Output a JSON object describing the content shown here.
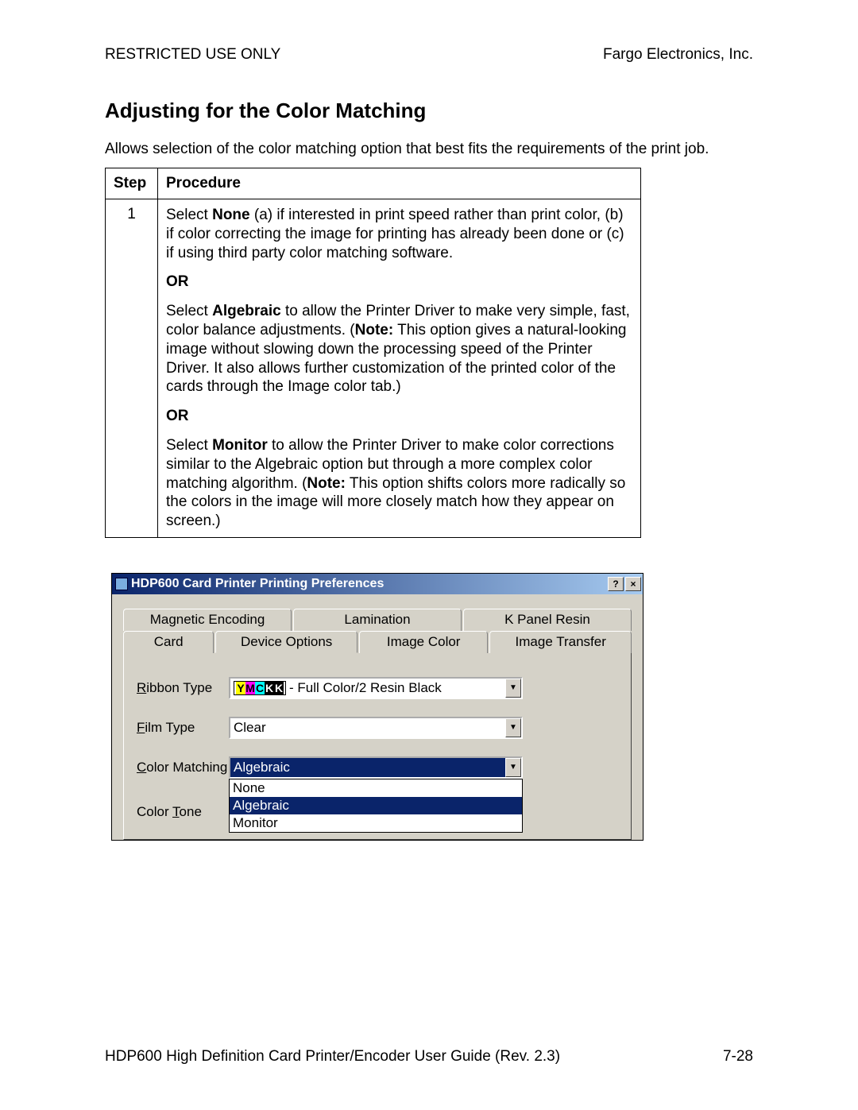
{
  "header": {
    "left": "RESTRICTED USE ONLY",
    "right": "Fargo Electronics, Inc."
  },
  "title": "Adjusting for the Color Matching",
  "intro": "Allows selection of the color matching option that best fits the requirements of the print job.",
  "table": {
    "head_step": "Step",
    "head_proc": "Procedure",
    "step_num": "1",
    "p1_pre": "Select ",
    "p1_bold": "None",
    "p1_post": " (a) if interested in print speed rather than print color, (b) if color correcting the image for printing has already been done or (c) if using third party color matching software.",
    "or1": "OR",
    "p2_pre": "Select ",
    "p2_bold1": "Algebraic",
    "p2_mid": " to allow the Printer Driver to make very simple, fast, color balance adjustments. (",
    "p2_bold2": "Note:",
    "p2_post": "  This option gives a natural-looking image without slowing down the processing speed of the Printer Driver. It also allows further customization of the printed color of the cards through the Image color tab.)",
    "or2": "OR",
    "p3_pre": "Select ",
    "p3_bold1": "Monitor",
    "p3_mid": " to allow the Printer Driver to make color corrections similar to the Algebraic option but through a more complex color matching algorithm. (",
    "p3_bold2": "Note:",
    "p3_post": "  This option shifts colors more radically so the colors in the image will more closely match how they appear on screen.)"
  },
  "dialog": {
    "title": "HDP600 Card Printer Printing Preferences",
    "help_btn": "?",
    "close_btn": "×",
    "tabs_row1": {
      "t1": "Magnetic Encoding",
      "t2": "Lamination",
      "t3": "K Panel Resin"
    },
    "tabs_row2": {
      "t1": "Card",
      "t2": "Device Options",
      "t3": "Image Color",
      "t4": "Image Transfer"
    },
    "labels": {
      "ribbon_u": "R",
      "ribbon_rest": "ibbon Type",
      "film_u": "F",
      "film_rest": "ilm Type",
      "color_u": "C",
      "color_rest": "olor Matching",
      "tone_pre": "Color ",
      "tone_u": "T",
      "tone_rest": "one"
    },
    "ribbon_label_letters": {
      "y": "Y",
      "m": "M",
      "c": "C",
      "k1": "K",
      "k2": "K"
    },
    "ribbon_value_rest": " - Full Color/2 Resin Black",
    "film_value": "Clear",
    "color_value": "Algebraic",
    "dropdown": {
      "opt_none": "None",
      "opt_algebraic": "Algebraic",
      "opt_monitor": "Monitor"
    }
  },
  "footer": {
    "left": "HDP600 High Definition Card Printer/Encoder User Guide (Rev. 2.3)",
    "right": "7-28"
  }
}
